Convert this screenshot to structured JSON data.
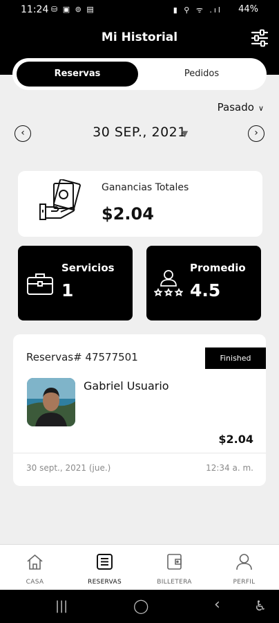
{
  "status_bar": {
    "time": "11:24",
    "left_icons": "⛁ ▣ ⊚ ▤",
    "right_icons": "▮ ⚲ ᯤ .ıl",
    "battery": "44%"
  },
  "header": {
    "title": "Mi Historial",
    "filter_icon": "sliders-icon"
  },
  "tabs": [
    {
      "label": "Reservas",
      "active": true
    },
    {
      "label": "Pedidos",
      "active": false
    }
  ],
  "period": {
    "label": "Pasado"
  },
  "date_nav": {
    "date": "30 SEP., 2021",
    "prev_icon": "chevron-left-icon",
    "next_icon": "chevron-right-icon"
  },
  "earnings": {
    "label": "Ganancias Totales",
    "value": "$2.04",
    "icon": "cash-hand-icon"
  },
  "stats": {
    "services": {
      "label": "Servicios",
      "value": "1",
      "icon": "briefcase-icon"
    },
    "average": {
      "label": "Promedio",
      "value": "4.5",
      "icon": "person-rating-icon"
    }
  },
  "booking": {
    "id_label": "Reservas# 47577501",
    "status": "Finished",
    "client": "Gabriel Usuario",
    "amount": "$2.04",
    "date": "30 sept., 2021 (jue.)",
    "time": "12:34 a. m."
  },
  "bottom_nav": [
    {
      "label": "CASA",
      "icon": "home-icon",
      "active": false
    },
    {
      "label": "RESERVAS",
      "icon": "list-icon",
      "active": true
    },
    {
      "label": "BILLETERA",
      "icon": "wallet-icon",
      "active": false
    },
    {
      "label": "PERFIL",
      "icon": "user-icon",
      "active": false
    }
  ],
  "colors": {
    "header_bg": "#000000",
    "page_bg": "#efefef",
    "card_bg": "#ffffff",
    "accent": "#000000"
  }
}
